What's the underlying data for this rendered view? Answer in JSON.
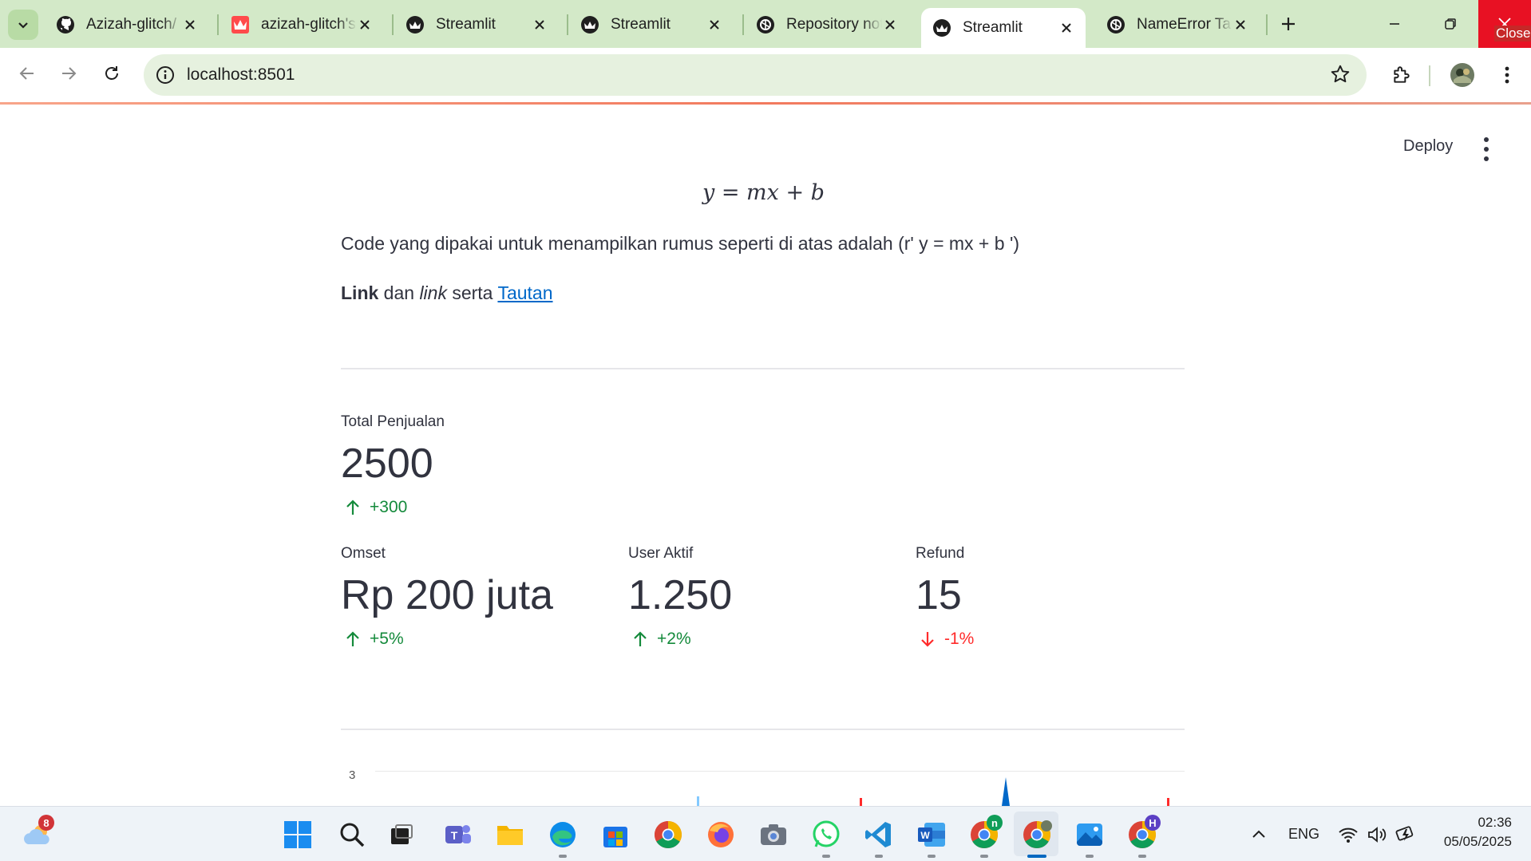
{
  "browser": {
    "tabs": [
      {
        "title": "Azizah-glitch/",
        "icon": "github-icon",
        "active": false
      },
      {
        "title": "azizah-glitch's",
        "icon": "streamlit-cloud-icon",
        "active": false
      },
      {
        "title": "Streamlit",
        "icon": "streamlit-icon",
        "active": false
      },
      {
        "title": "Streamlit",
        "icon": "streamlit-icon",
        "active": false
      },
      {
        "title": "Repository not",
        "icon": "chatgpt-icon",
        "active": false
      },
      {
        "title": "Streamlit",
        "icon": "streamlit-icon",
        "active": true
      },
      {
        "title": "NameError Ta",
        "icon": "chatgpt-icon",
        "active": false
      }
    ],
    "close_tooltip": "Close",
    "url": "localhost:8501"
  },
  "app": {
    "deploy_label": "Deploy",
    "formula": "y = mx + b",
    "paragraph1": "Code yang dipakai untuk menampilkan rumus seperti di atas adalah (r' y = mx + b ')",
    "paragraph2": {
      "bold": "Link",
      "text1": " dan ",
      "italic": "link",
      "text2": " serta ",
      "link": "Tautan"
    },
    "metrics": [
      {
        "label": "Total Penjualan",
        "value": "2500",
        "delta": "+300",
        "direction": "up"
      },
      {
        "label": "Omset",
        "value": "Rp 200 juta",
        "delta": "+5%",
        "direction": "up"
      },
      {
        "label": "User Aktif",
        "value": "1.250",
        "delta": "+2%",
        "direction": "up"
      },
      {
        "label": "Refund",
        "value": "15",
        "delta": "-1%",
        "direction": "down"
      }
    ],
    "chart": {
      "y_tick_top": "3"
    },
    "colors": {
      "delta_up": "#148a3b",
      "delta_down": "#ff2b2b",
      "link": "#0068c9"
    }
  },
  "taskbar": {
    "weather_badge": "8",
    "language": "ENG",
    "time": "02:36",
    "date": "05/05/2025",
    "chrome_profile_badges": [
      "n",
      "H"
    ]
  }
}
